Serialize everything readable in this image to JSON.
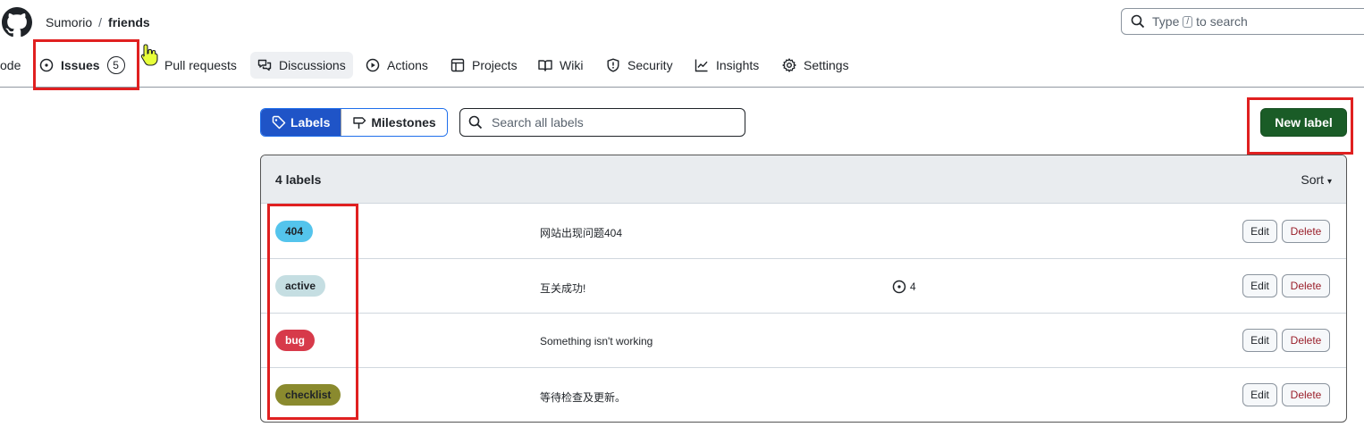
{
  "header": {
    "owner": "Sumorio",
    "separator": "/",
    "repo": "friends",
    "search_prefix": "Type",
    "search_key": "/",
    "search_suffix": "to search"
  },
  "nav": {
    "code": "ode",
    "issues": "Issues",
    "issues_count": "5",
    "pull_requests": "Pull requests",
    "discussions": "Discussions",
    "actions": "Actions",
    "projects": "Projects",
    "wiki": "Wiki",
    "security": "Security",
    "insights": "Insights",
    "settings": "Settings"
  },
  "toolbar": {
    "labels_tab": "Labels",
    "milestones_tab": "Milestones",
    "search_placeholder": "Search all labels",
    "new_label": "New label"
  },
  "list": {
    "count_text": "4 labels",
    "sort_label": "Sort",
    "labels": [
      {
        "name": "404",
        "description": "网站出现问题404",
        "issues": "",
        "color": "#54c4ec",
        "text_color": "#1f2328"
      },
      {
        "name": "active",
        "description": "互关成功!",
        "issues": "4",
        "color": "#c5dee2",
        "text_color": "#1f2328"
      },
      {
        "name": "bug",
        "description": "Something isn't working",
        "issues": "",
        "color": "#d73a4a",
        "text_color": "#ffffff"
      },
      {
        "name": "checklist",
        "description": "等待检查及更新。",
        "issues": "",
        "color": "#8a8a2e",
        "text_color": "#1f2328"
      }
    ],
    "edit_label": "Edit",
    "delete_label": "Delete"
  },
  "colors": {
    "primary_button": "#1a5c27",
    "selected_tab": "#1f54c7",
    "annotation": "#e02020"
  }
}
